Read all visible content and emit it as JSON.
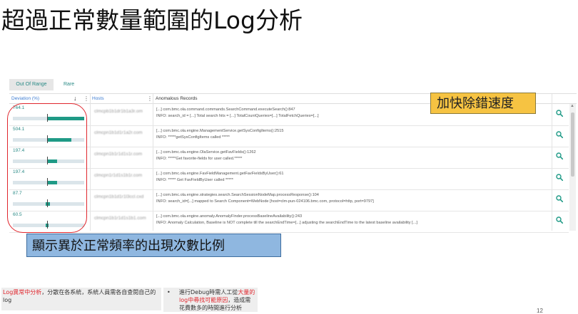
{
  "slide": {
    "title": "超過正常數量範圍的Log分析",
    "callout_fast": "加快除錯速度",
    "callout_ratio": "顯示異於正常頻率的出現次數比例",
    "page_number": "12"
  },
  "tabs": [
    {
      "label": "Out Of Range",
      "active": true
    },
    {
      "label": "Rare",
      "active": false
    }
  ],
  "grid": {
    "col_deviation": "Deviation (%)",
    "col_hosts": "Hosts",
    "col_records": "Anomalous Records",
    "sort_icon": "arrow-down",
    "kebab": "⋮",
    "rows": [
      {
        "deviation": "764.1",
        "fraction": 1.0,
        "host": "clmcpb1b1dr1b1a3r.om",
        "line1": "[...] com.bmc.ola.command.commands.SearchCommand.executeSearch():847",
        "line2": "INFO: search_id = [...] Total search hits = [...] TotalCountQueries=[...] TotalFetchQueries=[...]"
      },
      {
        "deviation": "504.1",
        "fraction": 0.66,
        "host": "clmcpn1b1d1r1a2r.com",
        "line1": "[...] com.bmc.ola.engine.ManagementService.getSysConfigItems():2515",
        "line2": "INFO: *****getSysConfigItems called *****"
      },
      {
        "deviation": "197.4",
        "fraction": 0.26,
        "host": "clmcpn1b1r1d1s1r.com",
        "line1": "[...] com.bmc.ola.engine.OlaService.getFavFields():1262",
        "line2": "INFO: *****Get favorite-fields for user called.*****"
      },
      {
        "deviation": "197.4",
        "fraction": 0.26,
        "host": "clmcpn1r1d1s1b1r.com",
        "line1": "[...] com.bmc.ola.engine.FavFieldManagement.getFavFieldsByUser():61",
        "line2": "INFO: ***** Get FavFieldByUser called *****"
      },
      {
        "deviation": "87.7",
        "fraction": 0.11,
        "host": "clmcpn1b1d1r1l3ccl.cxd",
        "line1": "[...] com.bmc.ola.engine.strategies.search.SearchSessionNodeMap.processResponse():104",
        "line2": "INFO: search_id=[...] mapped to Search Component=WebNode [host=clm-pun-024106.bmc.com, protocol=http, port=9797]"
      },
      {
        "deviation": "60.5",
        "fraction": 0.08,
        "host": "clmcpn1b1r1d1s1b1.com",
        "line1": "[...] com.bmc.ola.engine.anomaly.AnomalyFinder.processBaselineAvailability():243",
        "line2": "INFO: Anomaly Calculation, Baseline is NOT complete till the searchEndTime=[...] adjusting the searchEndTime to the latest baseline availability [...]"
      }
    ]
  },
  "footer": {
    "left_red": "Log異常中分析",
    "left_rest": "，分散在各系統，系統人員需各自查閱自己的log",
    "right_bullet": "•",
    "right_pre": "進行Debug時需人工從",
    "right_red": "大量的log中尋找可能原因",
    "right_post": "，造成需花費數多的時間進行分析"
  },
  "colors": {
    "teal": "#1f9a86",
    "callout_yellow": "#f6c342",
    "callout_blue": "#8fb7e0",
    "ellipse_red": "#e0262d"
  }
}
